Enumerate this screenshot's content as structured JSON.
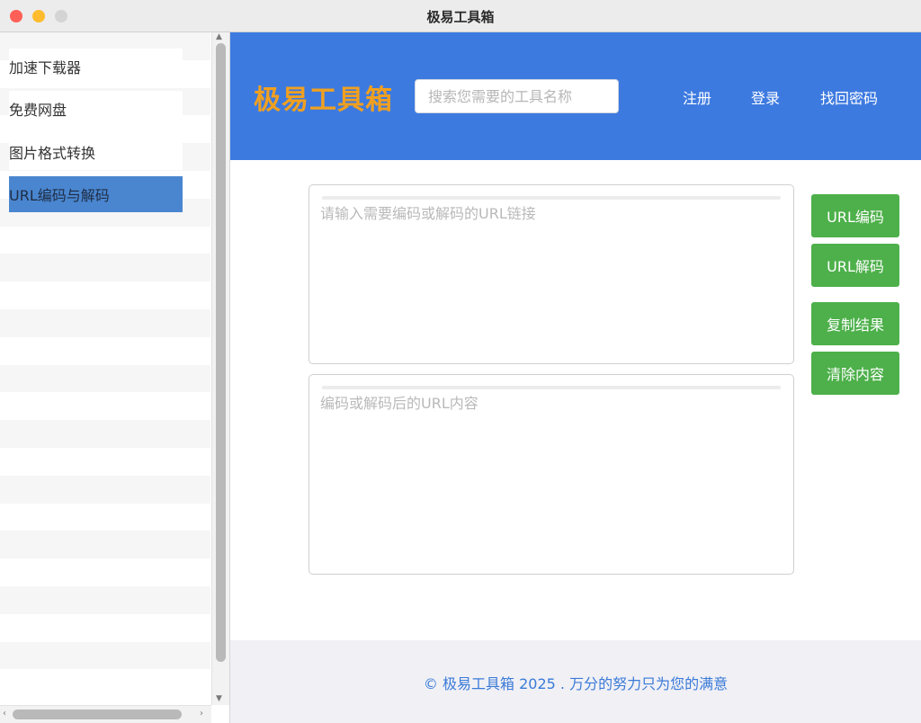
{
  "window": {
    "title": "极易工具箱"
  },
  "sidebar": {
    "items": [
      {
        "label": "加速下载器",
        "selected": false
      },
      {
        "label": "免费网盘",
        "selected": false
      },
      {
        "label": "图片格式转换",
        "selected": false
      },
      {
        "label": "URL编码与解码",
        "selected": true
      }
    ]
  },
  "header": {
    "brand": "极易工具箱",
    "search_placeholder": "搜索您需要的工具名称",
    "nav": {
      "register": "注册",
      "login": "登录",
      "forgot_password": "找回密码"
    }
  },
  "main": {
    "input_placeholder": "请输入需要编码或解码的URL链接",
    "output_placeholder": "编码或解码后的URL内容",
    "buttons": {
      "encode": "URL编码",
      "decode": "URL解码",
      "copy": "复制结果",
      "clear": "清除内容"
    }
  },
  "footer": {
    "text": "© 极易工具箱 2025 . 万分的努力只为您的满意"
  },
  "colors": {
    "header_bg": "#3d7ae0",
    "brand": "#f0a020",
    "button_green": "#4db04a",
    "selected_item": "#4a86d0",
    "footer_text": "#3a7ad8"
  }
}
